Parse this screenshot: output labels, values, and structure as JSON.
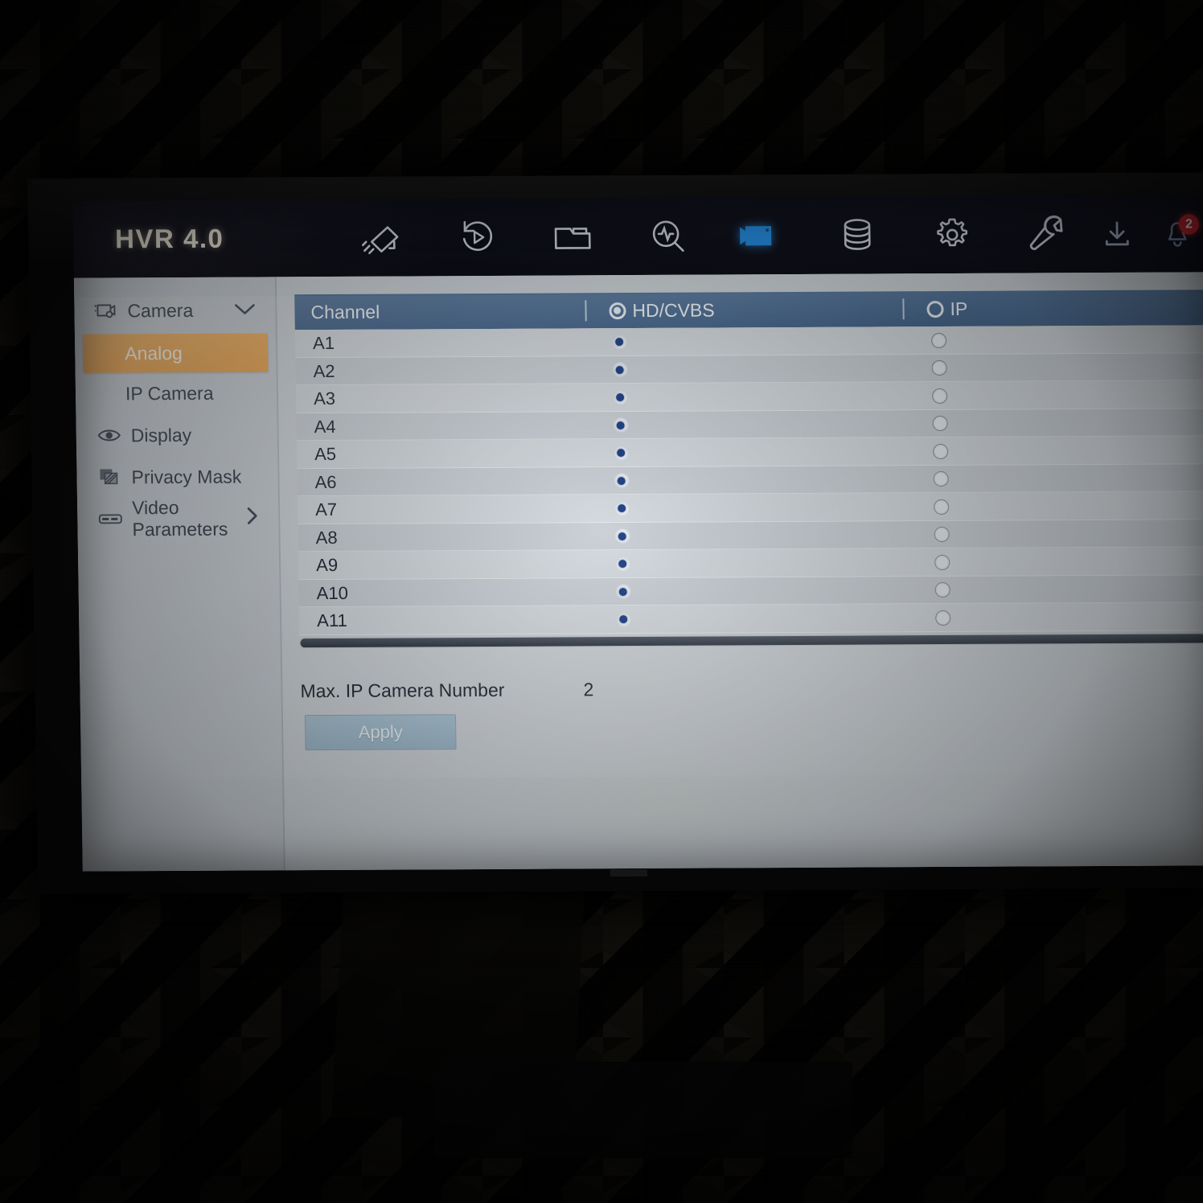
{
  "device": {
    "logo": "HVR 4.0"
  },
  "topnav": {
    "items": [
      {
        "name": "live-view-icon",
        "label": "Live View",
        "active": false
      },
      {
        "name": "playback-icon",
        "label": "Playback",
        "active": false
      },
      {
        "name": "file-folder-icon",
        "label": "File Management",
        "active": false
      },
      {
        "name": "smart-search-icon",
        "label": "Smart Analysis",
        "active": false
      },
      {
        "name": "camera-setup-icon",
        "label": "Camera",
        "active": true
      },
      {
        "name": "storage-database-icon",
        "label": "Storage",
        "active": false
      },
      {
        "name": "settings-gear-icon",
        "label": "System",
        "active": false
      },
      {
        "name": "maintenance-wrench-icon",
        "label": "Maintenance",
        "active": false
      }
    ],
    "right": [
      {
        "name": "download-icon",
        "label": "Download"
      },
      {
        "name": "alarm-icon",
        "label": "Alarm",
        "badge": "2"
      }
    ]
  },
  "sidebar": {
    "group": {
      "label": "Camera",
      "icon": "camera-icon",
      "chevron": "chevron-down-icon"
    },
    "items": [
      {
        "label": "Analog",
        "icon": "",
        "active": true,
        "chevron": ""
      },
      {
        "label": "IP Camera",
        "icon": "",
        "active": false,
        "chevron": ""
      },
      {
        "label": "Display",
        "icon": "eye-icon",
        "active": false,
        "chevron": ""
      },
      {
        "label": "Privacy Mask",
        "icon": "privacy-mask-icon",
        "active": false,
        "chevron": ""
      },
      {
        "label": "Video Parameters",
        "icon": "video-params-icon",
        "active": false,
        "chevron": "chevron-right-icon"
      }
    ]
  },
  "table": {
    "headers": {
      "channel": "Channel",
      "col1": {
        "label": "HD/CVBS",
        "selected": true
      },
      "col2": {
        "label": "IP",
        "selected": false
      }
    },
    "rows": [
      {
        "channel": "A1",
        "hd_cvbs": true,
        "ip": false
      },
      {
        "channel": "A2",
        "hd_cvbs": true,
        "ip": false
      },
      {
        "channel": "A3",
        "hd_cvbs": true,
        "ip": false
      },
      {
        "channel": "A4",
        "hd_cvbs": true,
        "ip": false
      },
      {
        "channel": "A5",
        "hd_cvbs": true,
        "ip": false
      },
      {
        "channel": "A6",
        "hd_cvbs": true,
        "ip": false
      },
      {
        "channel": "A7",
        "hd_cvbs": true,
        "ip": false
      },
      {
        "channel": "A8",
        "hd_cvbs": true,
        "ip": false
      },
      {
        "channel": "A9",
        "hd_cvbs": true,
        "ip": false
      },
      {
        "channel": "A10",
        "hd_cvbs": true,
        "ip": false
      },
      {
        "channel": "A11",
        "hd_cvbs": true,
        "ip": false
      }
    ]
  },
  "footer": {
    "max_ip_label": "Max. IP Camera Number",
    "max_ip_value": "2",
    "apply_label": "Apply"
  },
  "colors": {
    "accent_orange": "#eaa24d",
    "header_blue": "#41628a",
    "radio_selected": "#173a80",
    "alarm_red": "#d8222c",
    "panel_gray": "#ccd2d7",
    "nav_dark": "#05060f",
    "apply_blue": "#9ab7cb"
  }
}
